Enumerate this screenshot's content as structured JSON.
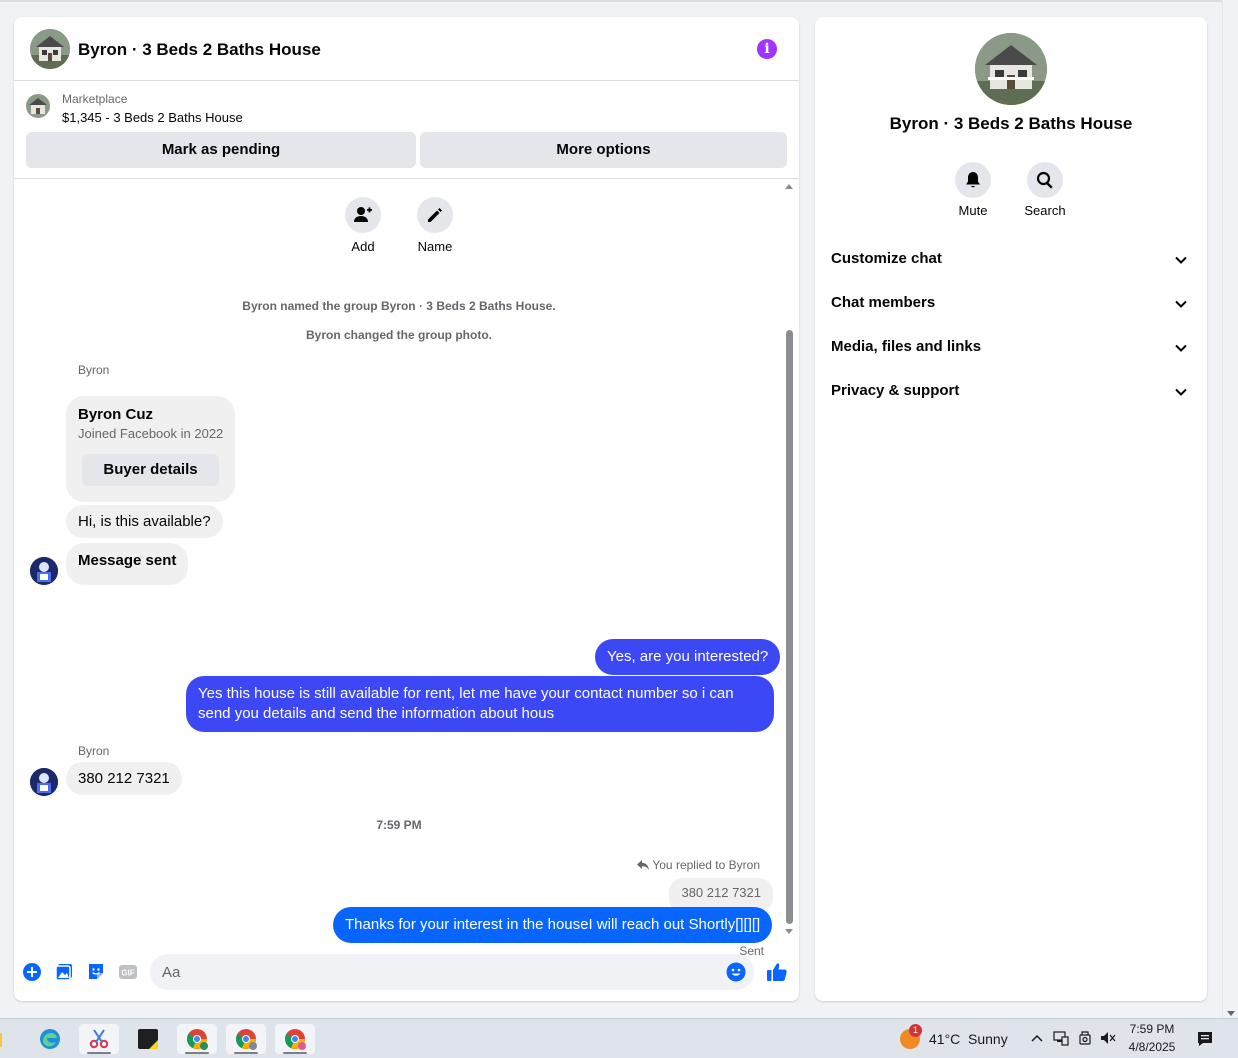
{
  "chat": {
    "title": "Byron · 3 Beds 2 Baths House",
    "marketplace_label": "Marketplace",
    "listing": "$1,345 - 3 Beds 2 Baths House",
    "mark_pending": "Mark as pending",
    "more_options": "More options",
    "actions": {
      "add": "Add",
      "name": "Name"
    },
    "system_messages": [
      "Byron named the group Byron · 3 Beds 2 Baths House.",
      "Byron changed the group photo."
    ],
    "sender": "Byron",
    "profile_card": {
      "name": "Byron Cuz",
      "subtitle": "Joined Facebook in 2022",
      "button": "Buyer details"
    },
    "messages": {
      "in_1": "Hi, is this available?",
      "in_2": "Message sent",
      "out_1": "Yes, are you interested?",
      "out_2": "Yes this house is still available for rent, let me have your contact number so i can send you details and send the information about hous",
      "in_3": "380 212 7321",
      "timestamp": "7:59 PM",
      "reply_note": "You replied to Byron",
      "quoted": "380 212 7321",
      "out_3": "Thanks for your interest in the houseI will reach out Shortly[][][]",
      "status": "Sent"
    },
    "composer": {
      "placeholder": "Aa"
    }
  },
  "info_panel": {
    "title": "Byron · 3 Beds 2 Baths House",
    "mute": "Mute",
    "search": "Search",
    "sections": [
      "Customize chat",
      "Chat members",
      "Media, files and links",
      "Privacy & support"
    ]
  },
  "taskbar": {
    "weather_badge": "1",
    "temperature": "41°C",
    "condition": "Sunny",
    "time": "7:59 PM",
    "date": "4/8/2025"
  },
  "colors": {
    "accent": "#0866ff",
    "outgoing_bubble": "#3c48f5",
    "info_icon": "#a033ff"
  }
}
